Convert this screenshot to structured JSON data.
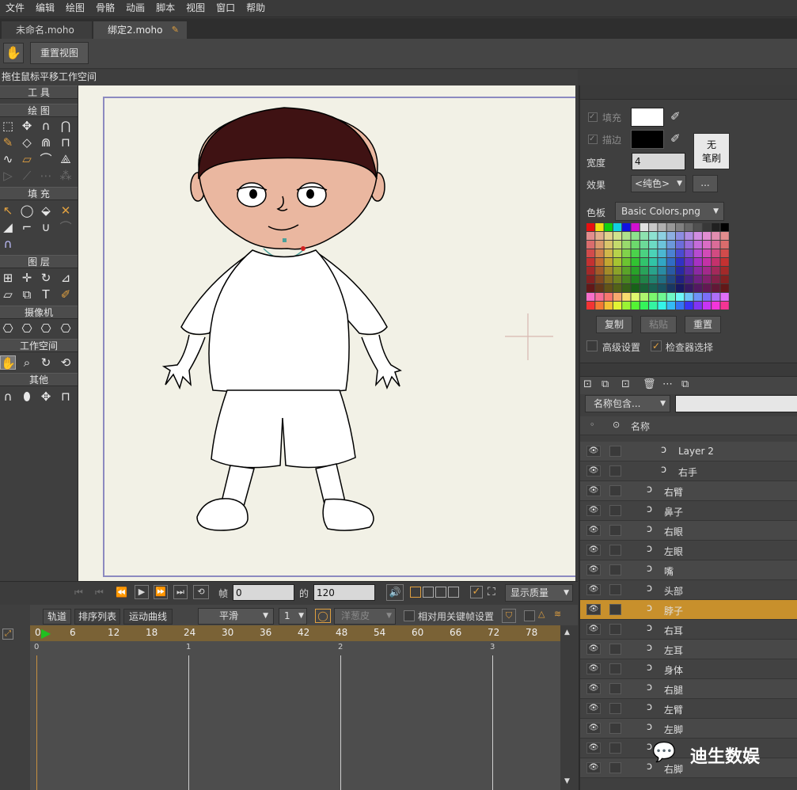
{
  "menu": [
    "文件",
    "编辑",
    "绘图",
    "骨骼",
    "动画",
    "脚本",
    "视图",
    "窗口",
    "帮助"
  ],
  "tabs": [
    {
      "label": "未命名.moho"
    },
    {
      "label": "绑定2.moho"
    }
  ],
  "topbar": {
    "hand_icon": "hand-icon",
    "reset_view_label": "重置视图"
  },
  "status_text": "拖住鼠标平移工作空间",
  "tools": {
    "title": "工 具",
    "sections": {
      "draw": "绘 图",
      "fill": "填 充",
      "layer": "图 层",
      "camera": "摄像机",
      "workspace": "工作空间",
      "other": "其他"
    }
  },
  "style_panel": {
    "fill_label": "填充",
    "stroke_label": "描边",
    "no_brush_line1": "无",
    "no_brush_line2": "笔刷",
    "width_label": "宽度",
    "width_value": "4",
    "effect_label": "效果",
    "effect_value": "<纯色>",
    "effect_more": "...",
    "palette_label": "色板",
    "palette_value": "Basic Colors.png",
    "copy_label": "复制",
    "paste_label": "粘贴",
    "reset_label": "重置",
    "advanced_label": "高级设置",
    "checker_label": "检查器选择",
    "fill_color": "#ffffff",
    "stroke_color": "#000000"
  },
  "layers_panel": {
    "filter_value": "名称包含...",
    "name_header": "名称",
    "rows": [
      {
        "name": "Layer 2",
        "indent": 2,
        "selected": false
      },
      {
        "name": "右手",
        "indent": 2,
        "selected": false
      },
      {
        "name": "右臂",
        "indent": 1,
        "selected": false
      },
      {
        "name": "鼻子",
        "indent": 1,
        "selected": false
      },
      {
        "name": "右眼",
        "indent": 1,
        "selected": false
      },
      {
        "name": "左眼",
        "indent": 1,
        "selected": false
      },
      {
        "name": "嘴",
        "indent": 1,
        "selected": false
      },
      {
        "name": "头部",
        "indent": 1,
        "selected": false
      },
      {
        "name": "脖子",
        "indent": 1,
        "selected": true
      },
      {
        "name": "右耳",
        "indent": 1,
        "selected": false
      },
      {
        "name": "左耳",
        "indent": 1,
        "selected": false
      },
      {
        "name": "身体",
        "indent": 1,
        "selected": false
      },
      {
        "name": "右腿",
        "indent": 1,
        "selected": false
      },
      {
        "name": "左臂",
        "indent": 1,
        "selected": false
      },
      {
        "name": "左脚",
        "indent": 1,
        "selected": false
      },
      {
        "name": "",
        "indent": 1,
        "selected": false
      },
      {
        "name": "右脚",
        "indent": 1,
        "selected": false
      }
    ],
    "selected_color": "#c8902c"
  },
  "playback": {
    "frame_label": "帧",
    "frame_value": "0",
    "of_label": "的",
    "total_value": "120",
    "quality_label": "显示质量"
  },
  "timeline": {
    "tabs": [
      "轨道",
      "排序列表",
      "运动曲线"
    ],
    "interp_value": "平滑",
    "count_value": "1",
    "onion_label": "洋葱皮",
    "relative_label": "相对用关键帧设置",
    "ruler": [
      "0",
      "6",
      "12",
      "18",
      "24",
      "30",
      "36",
      "42",
      "48",
      "54",
      "60",
      "66",
      "72",
      "78"
    ],
    "seconds": [
      "0",
      "1",
      "2",
      "3"
    ]
  },
  "watermark": "迪生数娱"
}
